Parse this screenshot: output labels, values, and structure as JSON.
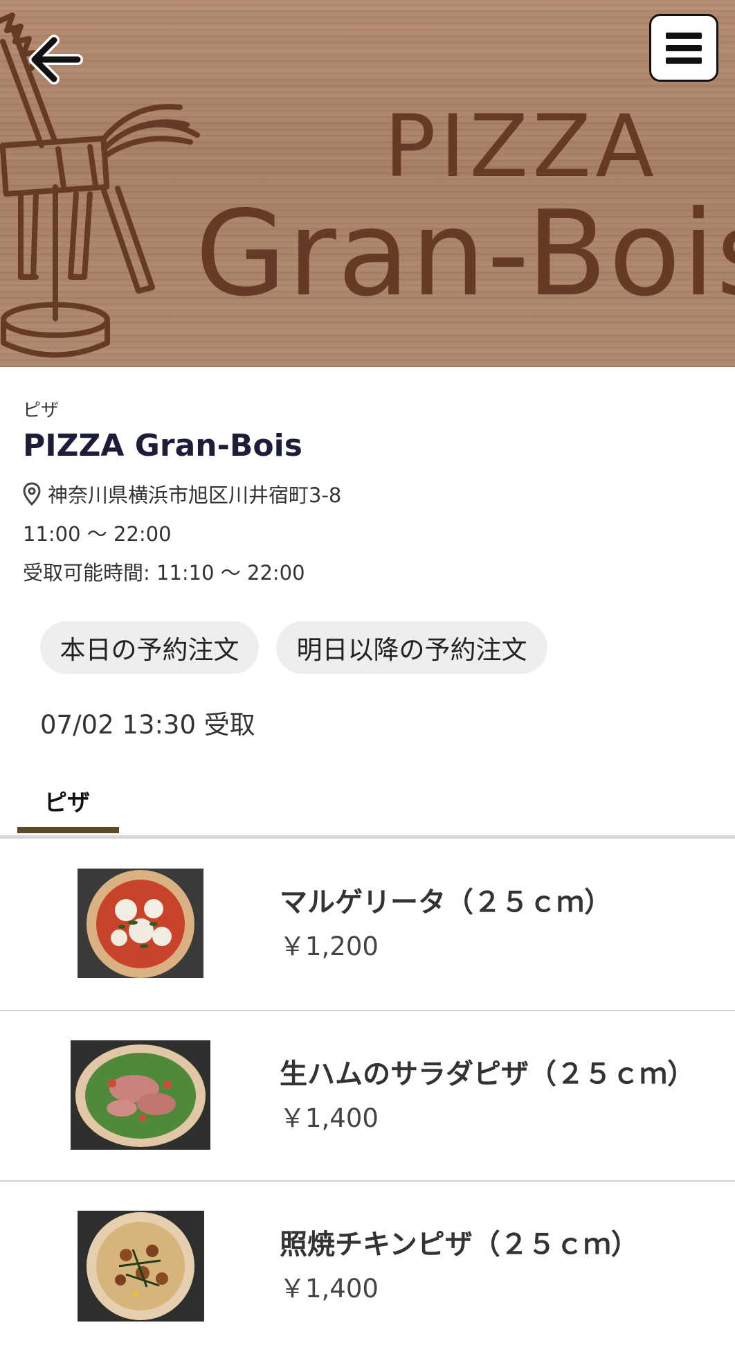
{
  "hero": {
    "logo_line1": "PIZZA",
    "logo_line2": "Gran-Bois"
  },
  "shop": {
    "category": "ピザ",
    "name": "PIZZA Gran-Bois",
    "address": "神奈川県横浜市旭区川井宿町3-8",
    "hours": "11:00 〜 22:00",
    "pickup_hours": "受取可能時間: 11:10 〜 22:00"
  },
  "order": {
    "today_label": "本日の予約注文",
    "later_label": "明日以降の予約注文",
    "pickup_slot": "07/02 13:30 受取"
  },
  "tabs": [
    {
      "label": "ピザ",
      "active": true
    }
  ],
  "menu": [
    {
      "name": "マルゲリータ（２５ｃｍ）",
      "price": "￥1,200"
    },
    {
      "name": "生ハムのサラダピザ（２５ｃｍ）",
      "price": "￥1,400"
    },
    {
      "name": "照焼チキンピザ（２５ｃｍ）",
      "price": "￥1,400"
    }
  ],
  "icons": {
    "back": "arrow-left-icon",
    "menu": "hamburger-menu-icon",
    "location": "map-pin-icon"
  },
  "colors": {
    "accent": "#5c4a2a",
    "title": "#1d1d3a",
    "chip_bg": "#eeeeee",
    "logo_brown": "#673a26"
  }
}
